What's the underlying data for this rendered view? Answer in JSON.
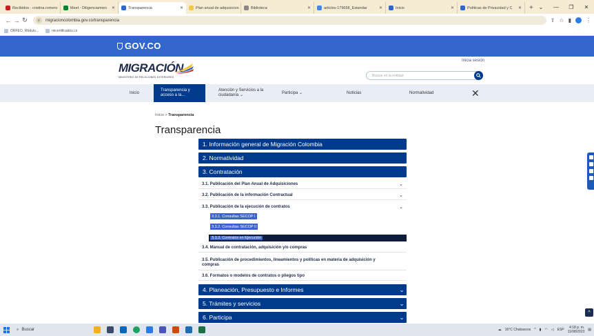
{
  "browser": {
    "tabs": [
      {
        "title": "Recibidos - cristina.romero",
        "color": "#c5221f",
        "active": false
      },
      {
        "title": "Meet - Diligenciamien",
        "color": "#00832d",
        "active": false
      },
      {
        "title": "Transparencia",
        "color": "#3366cc",
        "active": true
      },
      {
        "title": "Plan anual de adquisicion",
        "color": "#f2c94c",
        "active": false
      },
      {
        "title": "Biblioteca",
        "color": "#888888",
        "active": false
      },
      {
        "title": "articles-179658_Estandar",
        "color": "#4285f4",
        "active": false
      },
      {
        "title": "Inicio",
        "color": "#3366cc",
        "active": false
      },
      {
        "title": "Políticas de Privacidad y C",
        "color": "#3366cc",
        "active": false
      }
    ],
    "url": "migracioncolombia.gov.co/transparencia",
    "bookmarks": [
      "ORFEO, Módulo...",
      "micertificados.co"
    ]
  },
  "gov": {
    "logo_text": "GOV.CO"
  },
  "header": {
    "logo_text": "MIGRACIÓN",
    "logo_sub": "MINISTERIO DE RELACIONES EXTERIORES",
    "login": "Inicia sesión",
    "search_placeholder": "Buscar en la entidad"
  },
  "menu": {
    "items": [
      {
        "label": "Inicio"
      },
      {
        "label": "Transparencia y acceso a la...",
        "active": true
      },
      {
        "label": "Atención y Servicios a la ciudadanía ⌄"
      },
      {
        "label": "Participa ⌄"
      },
      {
        "label": "Noticias"
      },
      {
        "label": "Normatividad"
      }
    ],
    "close_symbol": "✕"
  },
  "breadcrumb": {
    "home": "Inicio",
    "sep": ">",
    "current": "Transparencia"
  },
  "page_title": "Transparencia",
  "sections": [
    "1. Información general de Migración Colombia",
    "2. Normatividad",
    "3. Contratación",
    "4. Planeación, Presupuesto e Informes",
    "5. Trámites y servicios",
    "6. Participa"
  ],
  "subsections": [
    "3.1. Publicación del Plan Anual de Adquisiciones",
    "3.2. Publicación de la información Contractual",
    "3.3. Publicación de la ejecución de contratos",
    "3.4. Manual de contratación, adquisición y/o compras",
    "3.5. Publicación de procedimientos, lineamientos y políticas en materia de adquisición y compras",
    "3.6. Formatos o modelos de contratos o pliegos tipo"
  ],
  "subsubsections": [
    "3.3.1. Consultas SECOP I",
    "3.3.2. Consultas SECOP II",
    "3.3.3. Contratos en Ejecución"
  ],
  "taskbar": {
    "search": "Buscar",
    "weather": "16°C Chubascos",
    "lang": "ESP",
    "time": "4:18 p. m.",
    "date": "11/08/2023"
  },
  "colors": {
    "gov_blue": "#3366cc",
    "nav_blue": "#003a8c",
    "highlight": "#3b63c9"
  }
}
